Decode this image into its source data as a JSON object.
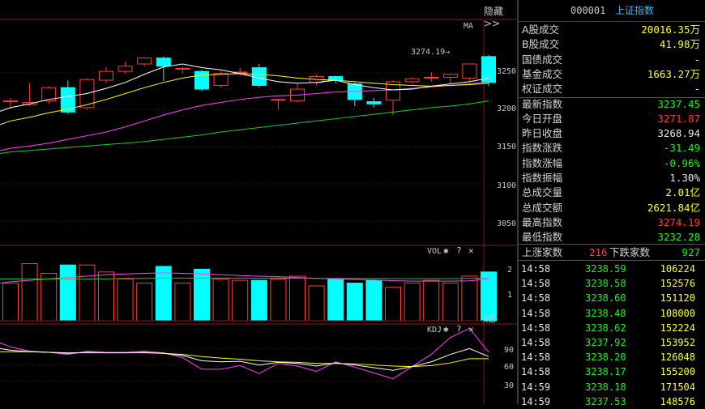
{
  "toolbar": {
    "hide_label": "隐藏>>",
    "ma_label": "MA"
  },
  "price_panel": {
    "y_ticks": [
      "3250",
      "3200",
      "3150",
      "3100",
      "3050"
    ],
    "high_annotation": "3274.19→"
  },
  "vol_panel": {
    "title": "VOL",
    "y_ticks": [
      "2",
      "1"
    ],
    "unit": "X亿"
  },
  "kdj_panel": {
    "title": "KDJ",
    "y_ticks": [
      "90",
      "60",
      "30"
    ]
  },
  "colors": {
    "up": "#ff3c3c",
    "down": "#00ffff",
    "ma5": "#ffffff",
    "ma10": "#ffff00",
    "ma20": "#ff44ff",
    "ma60": "#22cc22"
  },
  "stock": {
    "code": "000001",
    "name": "上证指数"
  },
  "quote": [
    {
      "label": "A股成交",
      "value": "20016.35万",
      "color": "yellow"
    },
    {
      "label": "B股成交",
      "value": "41.98万",
      "color": "yellow"
    },
    {
      "label": "国债成交",
      "value": "-",
      "color": "yellow"
    },
    {
      "label": "基金成交",
      "value": "1663.27万",
      "color": "yellow"
    },
    {
      "label": "权证成交",
      "value": "-",
      "color": "yellow"
    },
    {
      "label": "最新指数",
      "value": "3237.45",
      "color": "green"
    },
    {
      "label": "今日开盘",
      "value": "3271.87",
      "color": "red"
    },
    {
      "label": "昨日收盘",
      "value": "3268.94",
      "color": "white"
    },
    {
      "label": "指数涨跌",
      "value": "-31.49",
      "color": "green"
    },
    {
      "label": "指数涨幅",
      "value": "-0.96%",
      "color": "green"
    },
    {
      "label": "指数振幅",
      "value": "1.30%",
      "color": "white"
    },
    {
      "label": "总成交量",
      "value": "2.01亿",
      "color": "yellow"
    },
    {
      "label": "总成交额",
      "value": "2621.84亿",
      "color": "yellow"
    },
    {
      "label": "最高指数",
      "value": "3274.19",
      "color": "red"
    },
    {
      "label": "最低指数",
      "value": "3232.28",
      "color": "green"
    }
  ],
  "breadth": {
    "up_label": "上涨家数",
    "up_count": "216",
    "down_label": "下跌家数",
    "down_count": "927"
  },
  "ticks": [
    {
      "time": "14:58",
      "price": "3238.59",
      "volume": "106224"
    },
    {
      "time": "14:58",
      "price": "3238.58",
      "volume": "152576"
    },
    {
      "time": "14:58",
      "price": "3238.60",
      "volume": "151120"
    },
    {
      "time": "14:58",
      "price": "3238.48",
      "volume": "108000"
    },
    {
      "time": "14:58",
      "price": "3238.62",
      "volume": "152224"
    },
    {
      "time": "14:58",
      "price": "3237.92",
      "volume": "153952"
    },
    {
      "time": "14:58",
      "price": "3238.20",
      "volume": "126048"
    },
    {
      "time": "14:58",
      "price": "3238.17",
      "volume": "155200"
    },
    {
      "time": "14:59",
      "price": "3238.18",
      "volume": "171504"
    },
    {
      "time": "14:59",
      "price": "3237.53",
      "volume": "148576"
    }
  ],
  "chart_data": {
    "type": "candlestick",
    "price_range": [
      3020,
      3320
    ],
    "candles": [
      {
        "o": 3212,
        "c": 3212,
        "h": 3216,
        "l": 3203
      },
      {
        "o": 3207,
        "c": 3210,
        "h": 3236,
        "l": 3205
      },
      {
        "o": 3212,
        "c": 3230,
        "h": 3232,
        "l": 3208
      },
      {
        "o": 3230,
        "c": 3197,
        "h": 3240,
        "l": 3195
      },
      {
        "o": 3203,
        "c": 3241,
        "h": 3243,
        "l": 3200
      },
      {
        "o": 3240,
        "c": 3252,
        "h": 3258,
        "l": 3236
      },
      {
        "o": 3252,
        "c": 3259,
        "h": 3265,
        "l": 3249
      },
      {
        "o": 3262,
        "c": 3270,
        "h": 3271,
        "l": 3259
      },
      {
        "o": 3270,
        "c": 3259,
        "h": 3272,
        "l": 3239
      },
      {
        "o": 3255,
        "c": 3256,
        "h": 3258,
        "l": 3249
      },
      {
        "o": 3252,
        "c": 3228,
        "h": 3254,
        "l": 3225
      },
      {
        "o": 3233,
        "c": 3249,
        "h": 3252,
        "l": 3230
      },
      {
        "o": 3250,
        "c": 3251,
        "h": 3257,
        "l": 3246
      },
      {
        "o": 3257,
        "c": 3233,
        "h": 3262,
        "l": 3230
      },
      {
        "o": 3213,
        "c": 3214,
        "h": 3215,
        "l": 3200
      },
      {
        "o": 3212,
        "c": 3228,
        "h": 3235,
        "l": 3210
      },
      {
        "o": 3237,
        "c": 3245,
        "h": 3248,
        "l": 3233
      },
      {
        "o": 3245,
        "c": 3240,
        "h": 3246,
        "l": 3236
      },
      {
        "o": 3235,
        "c": 3214,
        "h": 3237,
        "l": 3205
      },
      {
        "o": 3211,
        "c": 3208,
        "h": 3216,
        "l": 3203
      },
      {
        "o": 3213,
        "c": 3238,
        "h": 3240,
        "l": 3193
      },
      {
        "o": 3238,
        "c": 3242,
        "h": 3244,
        "l": 3235
      },
      {
        "o": 3243,
        "c": 3244,
        "h": 3251,
        "l": 3238
      },
      {
        "o": 3244,
        "c": 3248,
        "h": 3249,
        "l": 3236
      },
      {
        "o": 3243,
        "c": 3262,
        "h": 3262,
        "l": 3239
      },
      {
        "o": 3272,
        "c": 3237,
        "h": 3274,
        "l": 3232
      }
    ],
    "ma5": [
      3203,
      3208,
      3214,
      3218,
      3222,
      3229,
      3237,
      3248,
      3258,
      3262,
      3257,
      3254,
      3249,
      3243,
      3238,
      3236,
      3237,
      3240,
      3234,
      3230,
      3227,
      3228,
      3232,
      3235,
      3238,
      3243
    ],
    "ma10": [
      3185,
      3190,
      3196,
      3201,
      3207,
      3214,
      3222,
      3230,
      3237,
      3243,
      3247,
      3248,
      3249,
      3248,
      3246,
      3243,
      3241,
      3240,
      3238,
      3236,
      3234,
      3233,
      3232,
      3233,
      3234,
      3236
    ],
    "ma20": [
      3148,
      3151,
      3155,
      3160,
      3165,
      3170,
      3177,
      3185,
      3193,
      3200,
      3206,
      3210,
      3214,
      3217,
      3219,
      3220,
      3222,
      3224,
      3225,
      3226,
      3227,
      3229,
      3231,
      3233,
      3235,
      3238
    ],
    "ma60": [
      3143,
      3145,
      3147,
      3149,
      3151,
      3153,
      3155,
      3157,
      3160,
      3163,
      3166,
      3170,
      3173,
      3176,
      3179,
      3182,
      3185,
      3188,
      3191,
      3194,
      3197,
      3200,
      3203,
      3205,
      3208,
      3212
    ],
    "vol_range": [
      0,
      2.5
    ],
    "volumes": [
      1.35,
      2.05,
      1.7,
      2.0,
      2.0,
      1.75,
      1.5,
      1.35,
      1.95,
      1.35,
      1.85,
      1.5,
      1.45,
      1.45,
      1.5,
      1.6,
      1.25,
      1.5,
      1.35,
      1.45,
      1.2,
      1.35,
      1.45,
      1.35,
      1.6,
      1.75
    ],
    "vol_ma1": [
      1.4,
      1.45,
      1.5,
      1.55,
      1.6,
      1.65,
      1.68,
      1.7,
      1.72,
      1.7,
      1.68,
      1.65,
      1.62,
      1.6,
      1.58,
      1.55,
      1.52,
      1.5,
      1.48,
      1.46,
      1.44,
      1.42,
      1.42,
      1.42,
      1.43,
      1.5
    ],
    "vol_ma2": [
      1.5,
      1.5,
      1.5,
      1.5,
      1.5,
      1.5,
      1.52,
      1.52,
      1.53,
      1.53,
      1.53,
      1.53,
      1.53,
      1.53,
      1.53,
      1.53,
      1.52,
      1.52,
      1.52,
      1.52,
      1.51,
      1.51,
      1.51,
      1.51,
      1.52,
      1.53
    ],
    "kdj_range": [
      0,
      100
    ],
    "k": [
      88,
      85,
      84,
      82,
      84,
      83,
      83,
      84,
      82,
      78,
      68,
      66,
      67,
      60,
      65,
      63,
      58,
      64,
      60,
      55,
      50,
      57,
      66,
      80,
      91,
      76
    ],
    "d": [
      85,
      85,
      84,
      83,
      83,
      83,
      83,
      83,
      82,
      80,
      76,
      73,
      71,
      68,
      66,
      65,
      63,
      63,
      62,
      60,
      58,
      57,
      59,
      64,
      72,
      72
    ],
    "j": [
      94,
      86,
      84,
      80,
      86,
      84,
      84,
      86,
      83,
      74,
      52,
      52,
      59,
      44,
      63,
      58,
      48,
      66,
      56,
      45,
      34,
      57,
      80,
      112,
      129,
      84
    ]
  }
}
